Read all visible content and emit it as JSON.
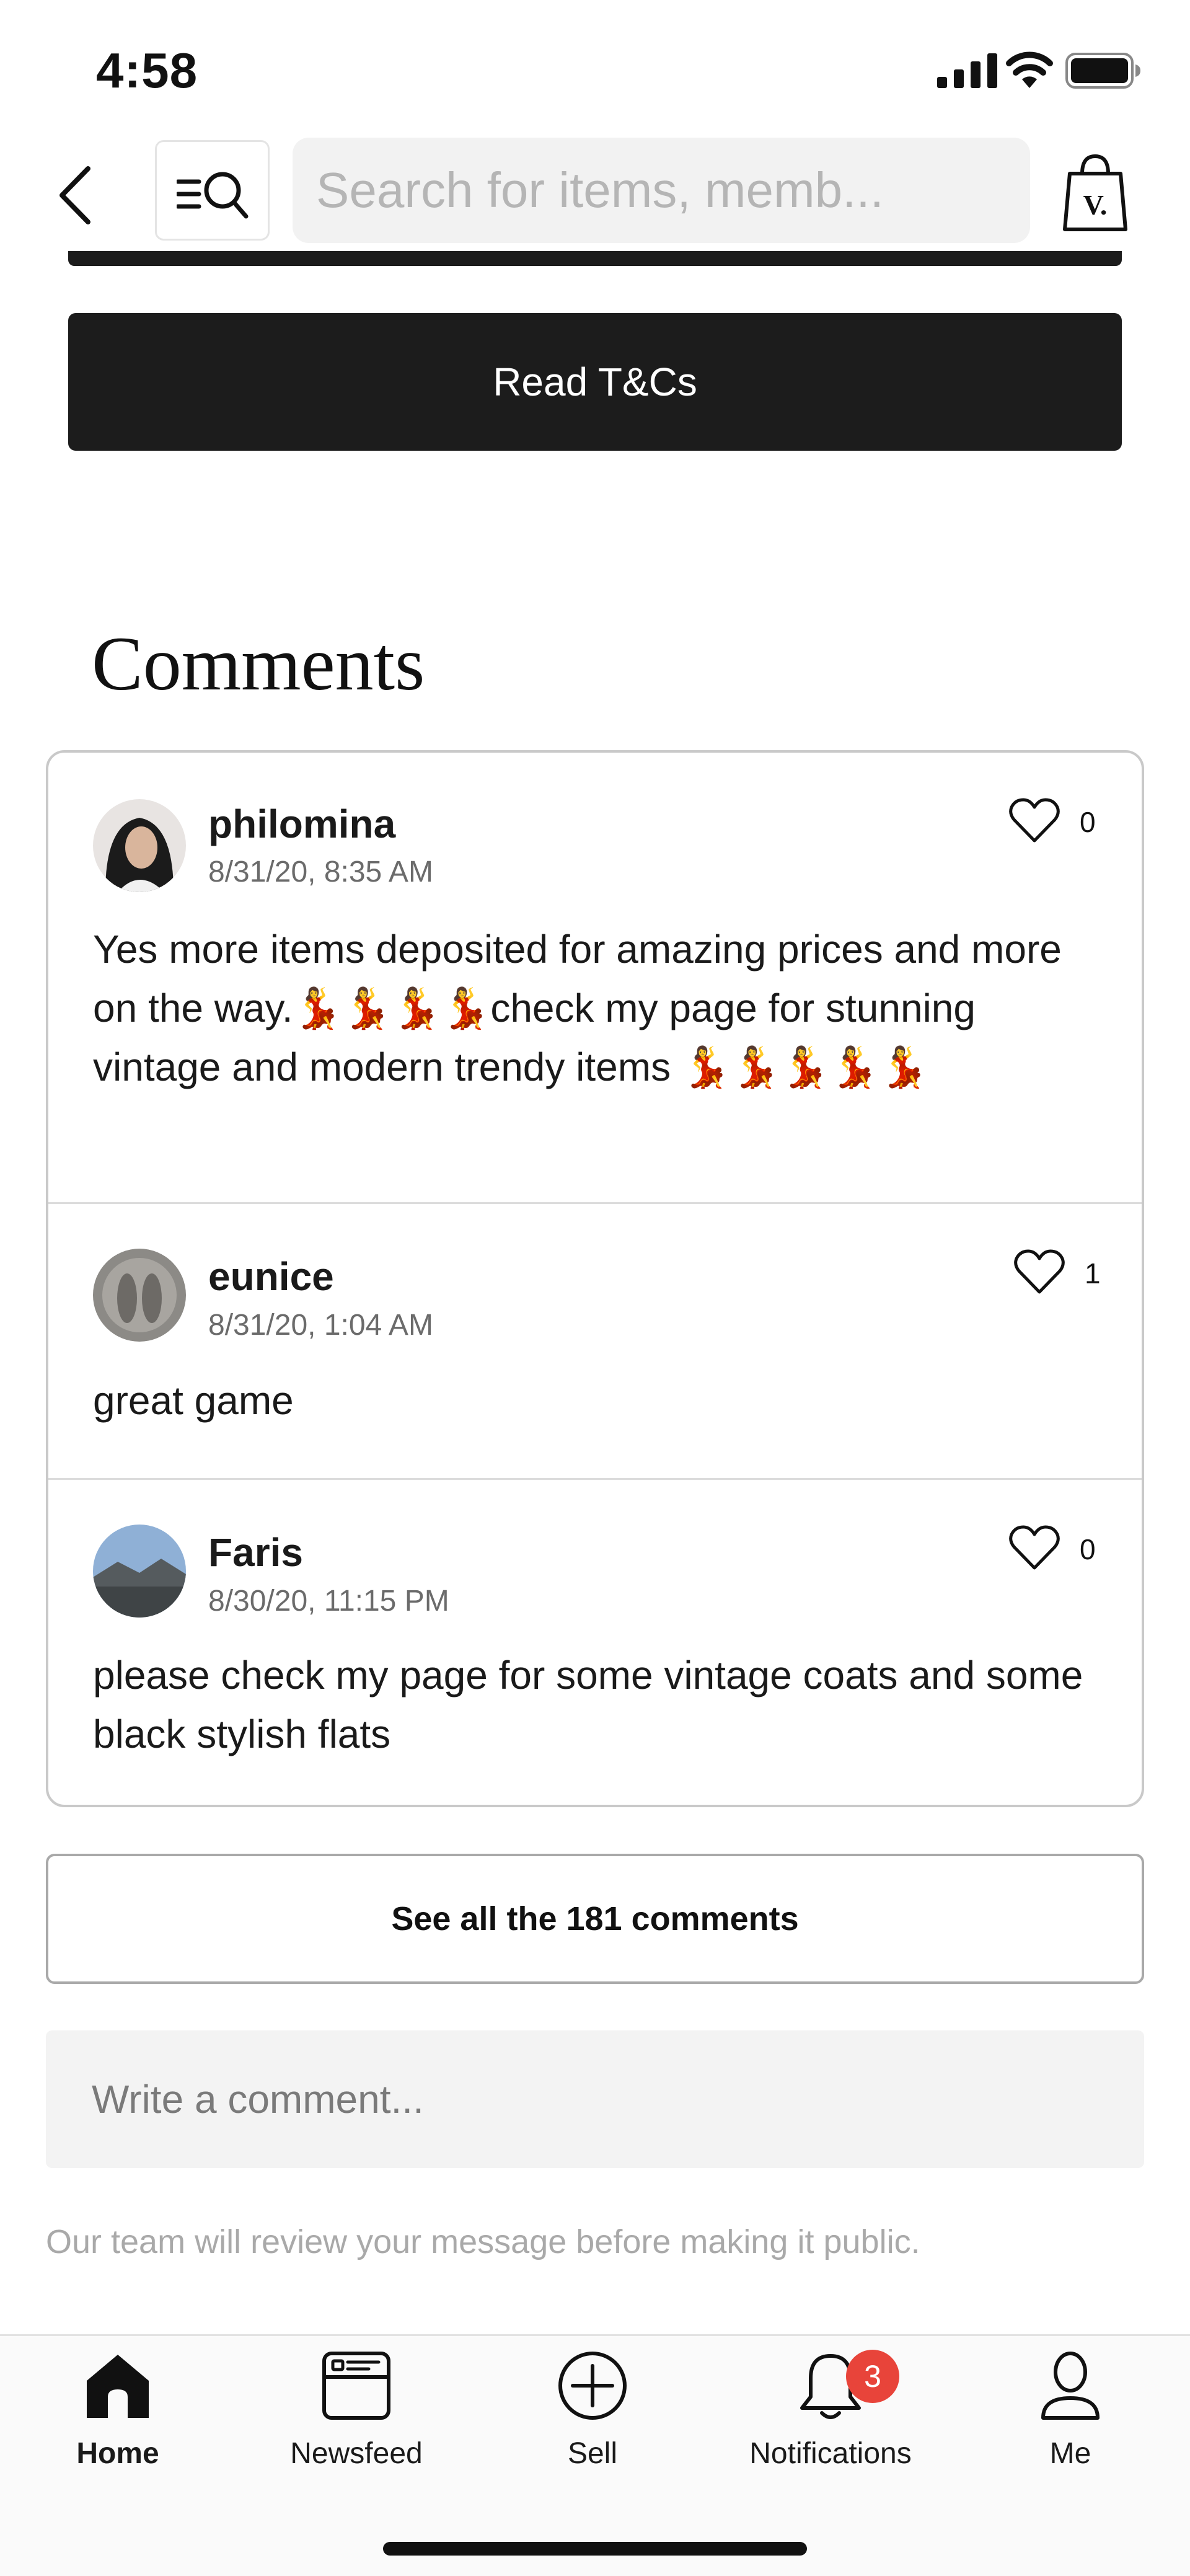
{
  "status_bar": {
    "time": "4:58"
  },
  "top_nav": {
    "search_placeholder": "Search for items, memb...",
    "bag_letter": "V."
  },
  "terms_button": {
    "label": "Read T&Cs"
  },
  "comments_section": {
    "title": "Comments",
    "comments": [
      {
        "author": "philomina",
        "date": "8/31/20, 8:35 AM",
        "likes": "0",
        "text": "Yes more items deposited for amazing prices and more on the way.💃💃💃💃check my page for stunning vintage and modern trendy items 💃💃💃💃💃"
      },
      {
        "author": "eunice",
        "date": "8/31/20, 1:04 AM",
        "likes": "1",
        "text": "great game"
      },
      {
        "author": "Faris",
        "date": "8/30/20, 11:15 PM",
        "likes": "0",
        "text": "please check my page for some vintage coats and some black stylish flats"
      }
    ],
    "see_all_label": "See all the 181 comments",
    "input_placeholder": "Write a comment...",
    "review_note": "Our team will review your message before making it public."
  },
  "tab_bar": {
    "tabs": [
      {
        "label": "Home",
        "icon": "home-icon",
        "active": true
      },
      {
        "label": "Newsfeed",
        "icon": "newsfeed-icon"
      },
      {
        "label": "Sell",
        "icon": "plus-circle-icon"
      },
      {
        "label": "Notifications",
        "icon": "bell-icon",
        "badge": "3"
      },
      {
        "label": "Me",
        "icon": "person-icon"
      }
    ]
  },
  "colors": {
    "primary_button": "#1c1c1c",
    "badge": "#e8443a",
    "search_field": "#f2f2f2",
    "muted_text": "#a9a9a9"
  }
}
